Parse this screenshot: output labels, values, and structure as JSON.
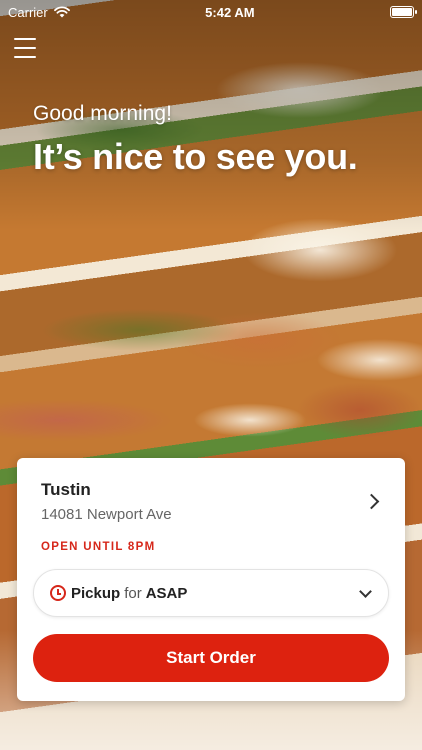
{
  "status_bar": {
    "carrier": "Carrier",
    "time": "5:42 AM",
    "wifi_icon": "wifi-icon",
    "battery_icon": "battery-icon"
  },
  "header": {
    "menu_icon": "hamburger-menu-icon",
    "greeting": "Good morning!",
    "headline": "It’s nice to see you."
  },
  "location": {
    "name": "Tustin",
    "address": "14081 Newport Ave",
    "status": "OPEN UNTIL 8PM",
    "chevron_icon": "chevron-right-icon"
  },
  "order_type": {
    "icon": "clock-icon",
    "method": "Pickup",
    "connector": "for",
    "time": "ASAP",
    "dropdown_icon": "chevron-down-icon"
  },
  "cta": {
    "label": "Start Order"
  },
  "colors": {
    "accent": "#dd220f",
    "status_red": "#d6271a",
    "card_bg": "#ffffff"
  }
}
